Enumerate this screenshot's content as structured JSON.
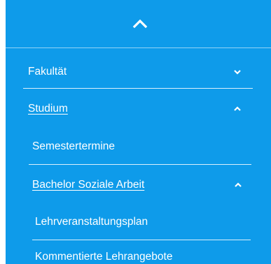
{
  "colors": {
    "background": "#0e9bea",
    "text": "#ffffff"
  },
  "topbar": {
    "icon": "chevron-up-icon"
  },
  "menu": {
    "fakultaet": {
      "label": "Fakultät",
      "icon": "chevron-down-icon"
    },
    "studium": {
      "label": "Studium",
      "icon": "chevron-up-icon",
      "active": true
    },
    "semestertermine": {
      "label": "Semestertermine"
    },
    "bachelor": {
      "label": "Bachelor Soziale Arbeit",
      "icon": "chevron-up-icon",
      "active": true
    },
    "lehrveranstaltungsplan": {
      "label": "Lehrveranstaltungsplan"
    },
    "kommentierte": {
      "label": "Kommentierte Lehrangebote"
    }
  }
}
